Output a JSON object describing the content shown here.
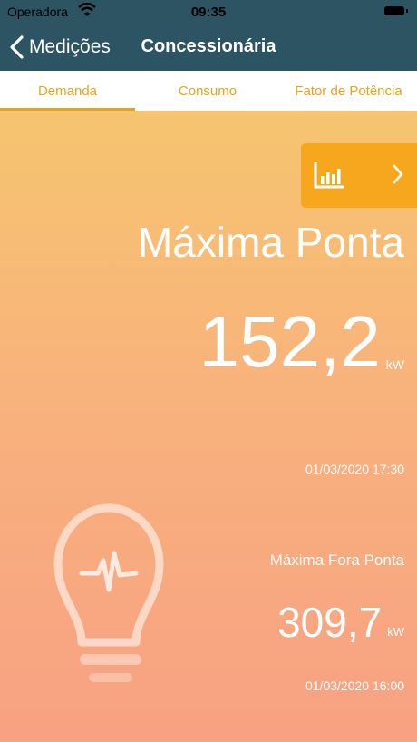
{
  "status_bar": {
    "carrier": "Operadora",
    "time": "09:35"
  },
  "nav": {
    "back_label": "Medições",
    "title": "Concessionária"
  },
  "tabs": [
    {
      "label": "Demanda",
      "selected": true
    },
    {
      "label": "Consumo",
      "selected": false
    },
    {
      "label": "Fator de Potência",
      "selected": false
    }
  ],
  "main": {
    "title": "Máxima Ponta",
    "value": "152,2",
    "unit": "kW",
    "date": "01/03/2020 17:30"
  },
  "secondary": {
    "title": "Máxima Fora Ponta",
    "value": "309,7",
    "unit": "kW",
    "date": "01/03/2020 16:00"
  },
  "colors": {
    "nav_bg": "#2d5462",
    "accent": "#f0a10f",
    "button_bg": "#f7a71d",
    "gradient_top": "#f6c56f",
    "gradient_bottom": "#f8a183"
  },
  "icons": [
    "wifi-icon",
    "battery-icon",
    "chevron-left-icon",
    "bar-chart-icon",
    "chevron-right-icon",
    "lightbulb-icon"
  ]
}
